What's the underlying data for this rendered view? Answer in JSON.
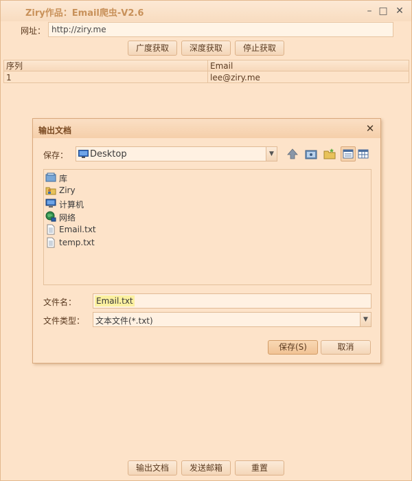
{
  "window": {
    "title": "Ziry作品：Email爬虫-V2.6"
  },
  "url_row": {
    "label": "网址：",
    "value": "http://ziry.me"
  },
  "top_buttons": {
    "broad": "广度获取",
    "deep": "深度获取",
    "stop": "停止获取"
  },
  "grid": {
    "columns": [
      "序列",
      "Email"
    ],
    "rows": [
      [
        "1",
        "lee@ziry.me"
      ]
    ]
  },
  "dialog": {
    "title": "输出文档",
    "save_in_label": "保存：",
    "save_in_value": "Desktop",
    "files": [
      {
        "name": "库",
        "icon": "library-icon"
      },
      {
        "name": "Ziry",
        "icon": "user-folder-icon"
      },
      {
        "name": "计算机",
        "icon": "computer-icon"
      },
      {
        "name": "网络",
        "icon": "network-icon"
      },
      {
        "name": "Email.txt",
        "icon": "text-file-icon"
      },
      {
        "name": "temp.txt",
        "icon": "text-file-icon"
      }
    ],
    "filename_label": "文件名：",
    "filename_value": "Email.txt",
    "filetype_label": "文件类型：",
    "filetype_value": "文本文件(*.txt)",
    "save_button": "保存(S)",
    "cancel_button": "取消"
  },
  "bottom_buttons": {
    "export": "输出文档",
    "send_mail": "发送邮箱",
    "reset": "重置"
  },
  "colors": {
    "background": "#fde3c9",
    "accent": "#c8915a",
    "border": "#e6c39f"
  }
}
